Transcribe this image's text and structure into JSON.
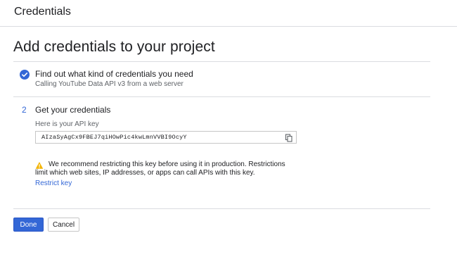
{
  "header": {
    "title": "Credentials"
  },
  "page": {
    "title": "Add credentials to your project"
  },
  "step1": {
    "title": "Find out what kind of credentials you need",
    "subtitle": "Calling YouTube Data API v3 from a web server",
    "status": "complete"
  },
  "step2": {
    "number": "2",
    "title": "Get your credentials",
    "api_key_label": "Here is your API key",
    "api_key_value": "AIzaSyAgCx9FBEJ7qiHOwPic4kwLmnVVBI9OcyY"
  },
  "warning": {
    "line1": "We recommend restricting this key before using it in production. Restrictions",
    "line2": "limit which web sites, IP addresses, or apps can call APIs with this key.",
    "link_label": "Restrict key"
  },
  "actions": {
    "done_label": "Done",
    "cancel_label": "Cancel"
  },
  "colors": {
    "accent": "#3367d6",
    "warning": "#f4b400",
    "divider": "#dadce0"
  },
  "icons": {
    "step1": "check-circle-icon",
    "copy": "copy-icon",
    "warning": "warning-icon"
  }
}
